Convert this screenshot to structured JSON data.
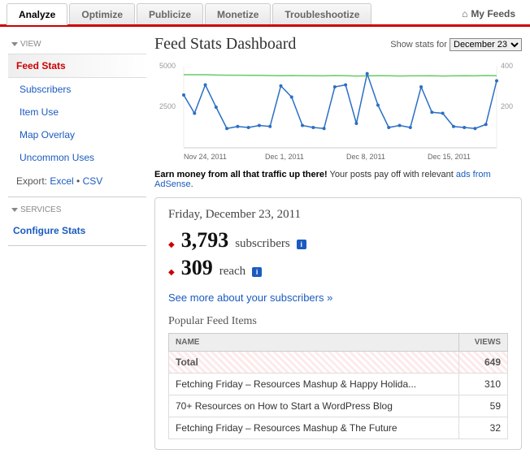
{
  "tabs": {
    "t0": "Analyze",
    "t1": "Optimize",
    "t2": "Publicize",
    "t3": "Monetize",
    "t4": "Troubleshootize",
    "myfeeds": "My Feeds"
  },
  "sidebar": {
    "view_section": "VIEW",
    "feed_stats": "Feed Stats",
    "subscribers": "Subscribers",
    "item_use": "Item Use",
    "map_overlay": "Map Overlay",
    "uncommon": "Uncommon Uses",
    "export_label": "Export:",
    "export_excel": "Excel",
    "export_csv": "CSV",
    "services_section": "SERVICES",
    "configure": "Configure Stats"
  },
  "header": {
    "title": "Feed Stats Dashboard",
    "show_stats": "Show stats for",
    "date_option": "December 23"
  },
  "earn": {
    "bold": "Earn money from all that traffic up there!",
    "rest": " Your posts pay off with relevant ",
    "link": "ads from AdSense",
    "dot": "."
  },
  "panel": {
    "date": "Friday, December 23, 2011",
    "subs_num": "3,793",
    "subs_label": "subscribers",
    "reach_num": "309",
    "reach_label": "reach",
    "seemore": "See more about your subscribers »",
    "popular": "Popular Feed Items",
    "th_name": "NAME",
    "th_views": "VIEWS",
    "total_label": "Total",
    "total_views": "649",
    "rows": [
      {
        "name": "Fetching Friday – Resources Mashup & Happy Holida...",
        "views": "310"
      },
      {
        "name": "70+ Resources on How to Start a WordPress Blog",
        "views": "59"
      },
      {
        "name": "Fetching Friday – Resources Mashup & The Future",
        "views": "32"
      }
    ]
  },
  "chart_data": {
    "type": "line",
    "title": "",
    "xlabel": "",
    "ylabel": "",
    "x_ticks": [
      "Nov 24, 2011",
      "Dec 1, 2011",
      "Dec 8, 2011",
      "Dec 15, 2011"
    ],
    "left_axis": {
      "range": [
        0,
        5000
      ],
      "ticks": [
        2500,
        5000
      ]
    },
    "right_axis": {
      "range": [
        0,
        400
      ],
      "ticks": [
        200,
        400
      ]
    },
    "series": [
      {
        "name": "subscribers",
        "axis": "left",
        "color": "#6c6",
        "values": [
          4500,
          4500,
          4500,
          4480,
          4470,
          4470,
          4460,
          4460,
          4450,
          4440,
          4450,
          4440,
          4440,
          4430,
          4450,
          4440,
          4420,
          4430,
          4440,
          4440,
          4420,
          4430,
          4430,
          4440,
          4420,
          4430,
          4440,
          4430,
          4450,
          4440
        ]
      },
      {
        "name": "reach",
        "axis": "right",
        "color": "#2b6fc4",
        "values": [
          260,
          170,
          310,
          200,
          95,
          105,
          100,
          110,
          105,
          305,
          250,
          110,
          100,
          95,
          300,
          310,
          120,
          365,
          210,
          100,
          110,
          100,
          300,
          175,
          170,
          105,
          100,
          95,
          115,
          330
        ]
      }
    ]
  }
}
